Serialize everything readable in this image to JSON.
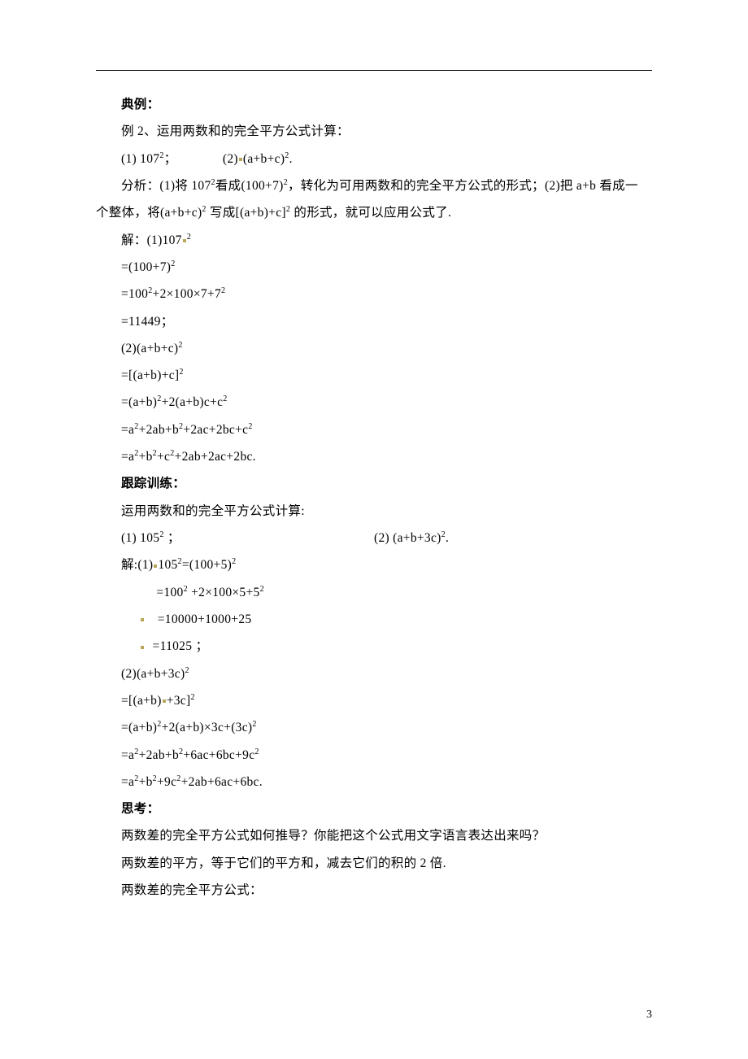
{
  "lines": {
    "h1": "典例：",
    "l1_pre": "例 2、运用两数和的完全平方公式计算：",
    "l2a": "(1) 107",
    "l2b": "；",
    "l2c": "(2)",
    "l2d": "(a+b+c)",
    "l2e": ".",
    "l3a": "分析：(1)将 107",
    "l3b": "看成(100+7)",
    "l3c": "，转化为可用两数和的完全平方公式的形式；(2)把 a+b 看成一",
    "l4a": "个整体，将(a+b+c)",
    "l4b": " 写成[(a+b)+c]",
    "l4c": " 的形式，就可以应用公式了.",
    "l5a": "解：(1)107",
    "l6a": "=(100+7)",
    "l7a": "=100",
    "l7b": "+2×100×7+7",
    "l8": "=11449；",
    "l9a": "(2)(a+b+c)",
    "l10a": "=[(a+b)+c]",
    "l11a": "=(a+b)",
    "l11b": "+2(a+b)c+c",
    "l12a": "=a",
    "l12b": "+2ab+b",
    "l12c": "+2ac+2bc+c",
    "l13a": "=a",
    "l13b": "+b",
    "l13c": "+c",
    "l13d": "+2ab+2ac+2bc.",
    "h2": "跟踪训练：",
    "l14": "运用两数和的完全平方公式计算:",
    "l15a": "(1) 105",
    "l15b": " ；",
    "l15c": "(2) (a+b+3c)",
    "l15d": ".",
    "l16a": "解:(1)",
    "l16b": "105",
    "l16c": "=(100+5)",
    "l17a": "=100",
    "l17b": " +2×100×5+5",
    "l18": "=10000+1000+25",
    "l19": "=11025 ；",
    "l20a": "(2)(a+b+3c)",
    "l21a": "=[(a+b)",
    "l21b": "+3c]",
    "l22a": "=(a+b)",
    "l22b": "+2(a+b)×3c+(3c)",
    "l23a": "=a",
    "l23b": "+2ab+b",
    "l23c": "+6ac+6bc+9c",
    "l24a": "=a",
    "l24b": "+b",
    "l24c": "+9c",
    "l24d": "+2ab+6ac+6bc.",
    "h3": "思考：",
    "l25": "两数差的完全平方公式如何推导？你能把这个公式用文字语言表达出来吗？",
    "l26": "两数差的平方，等于它们的平方和，减去它们的积的 2 倍.",
    "l27": "两数差的完全平方公式："
  },
  "sup2": "2",
  "pageNumber": "3"
}
